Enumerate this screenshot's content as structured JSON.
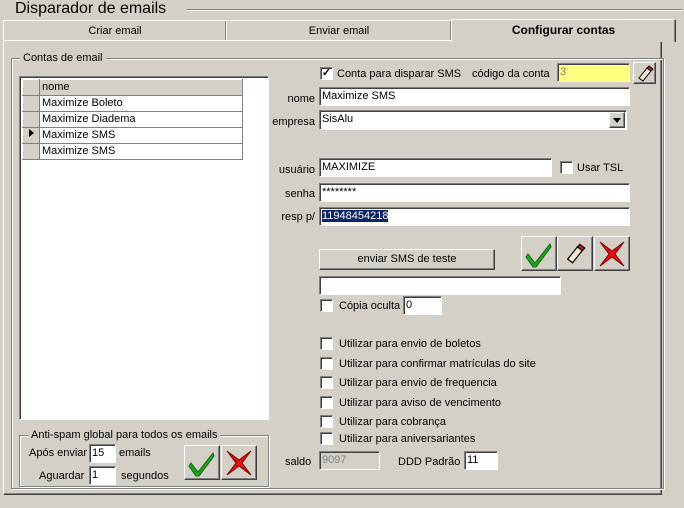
{
  "window": {
    "title": "Disparador de emails"
  },
  "tabs": [
    {
      "label": "Criar email"
    },
    {
      "label": "Enviar email"
    },
    {
      "label": "Configurar contas"
    }
  ],
  "contas": {
    "legend": "Contas de email",
    "column_header": "nome",
    "rows": [
      "Maximize Boleto",
      "Maximize Diadema",
      "Maximize SMS",
      "Maximize SMS"
    ],
    "selected_row": 2
  },
  "antispam": {
    "legend": "Anti-spam global para todos os emails",
    "apos_label": "Após enviar",
    "apos_value": "15",
    "apos_unit": "emails",
    "aguardar_label": "Aguardar",
    "aguardar_value": "1",
    "aguardar_unit": "segundos"
  },
  "form": {
    "sms_check_label": "Conta para disparar SMS",
    "sms_checked": true,
    "codigo_label": "código da conta",
    "codigo_value": "3",
    "nome_label": "nome",
    "nome_value": "Maximize SMS",
    "empresa_label": "empresa",
    "empresa_value": "SisAlu",
    "usuario_label": "usuário",
    "usuario_value": "MAXIMIZE",
    "tsl_label": "Usar TSL",
    "senha_label": "senha",
    "senha_value": "********",
    "resp_label": "resp p/",
    "resp_value": "11948454218",
    "test_button": "enviar SMS de teste",
    "test_field_value": "",
    "copia_label": "Cópia oculta",
    "copia_value": "0",
    "options": [
      "Utilizar para envio de boletos",
      "Utilizar para confirmar matrículas do site",
      "Utilizar para envio de frequencia",
      "Utilizar para aviso de vencimento",
      "Utilizar para cobrança",
      "Utilizar para aniversariantes"
    ],
    "saldo_label": "saldo",
    "saldo_value": "9097",
    "ddd_label": "DDD Padrão",
    "ddd_value": "11"
  },
  "colors": {
    "confirm": "#21a121",
    "cancel": "#e01010",
    "selection": "#0a246a"
  }
}
